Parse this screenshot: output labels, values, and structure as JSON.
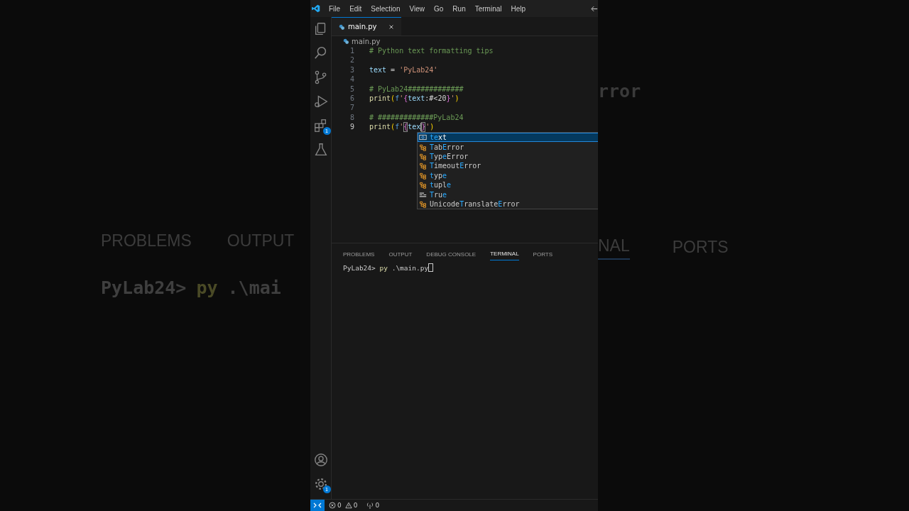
{
  "backdrop": {
    "left": [
      [
        {
          "kind": "tab",
          "text": "PROBLEMS"
        },
        {
          "kind": "tab",
          "text": "OUTPUT"
        }
      ],
      [
        {
          "kind": "prompt",
          "text": "PyLab24>"
        },
        {
          "kind": "command",
          "text": "py"
        },
        {
          "kind": "path",
          "text": ".\\mai"
        }
      ]
    ],
    "right": [
      [
        {
          "kind": "code",
          "text": "rror"
        }
      ],
      [
        {
          "kind": "active-tab",
          "text": "NAL"
        },
        {
          "kind": "tab",
          "text": "PORTS"
        }
      ]
    ]
  },
  "window": {
    "menu": [
      "File",
      "Edit",
      "Selection",
      "View",
      "Go",
      "Run",
      "Terminal",
      "Help"
    ]
  },
  "activity_bar": {
    "top": [
      {
        "kind": "files"
      },
      {
        "kind": "search"
      },
      {
        "kind": "branch"
      },
      {
        "kind": "run"
      },
      {
        "kind": "extensions",
        "badge": "1"
      },
      {
        "kind": "flask"
      }
    ],
    "bottom": [
      {
        "kind": "account"
      },
      {
        "kind": "gear",
        "badge": "1"
      }
    ]
  },
  "tabs": [
    {
      "label": "main.py",
      "selected": true
    }
  ],
  "breadcrumb": {
    "file": "main.py"
  },
  "editor": {
    "lines": [
      {
        "number": "1",
        "current": false,
        "tokens": [
          {
            "kind": "comment",
            "text": "# Python text formatting tips"
          }
        ]
      },
      {
        "number": "2",
        "current": false
      },
      {
        "number": "3",
        "current": false,
        "tokens": [
          {
            "kind": "variable",
            "text": "text"
          },
          {
            "kind": "operator",
            "text": " = "
          },
          {
            "kind": "string",
            "text": "'PyLab24'"
          }
        ]
      },
      {
        "number": "4",
        "current": false
      },
      {
        "number": "5",
        "current": false,
        "tokens": [
          {
            "kind": "comment",
            "text": "# PyLab24#############"
          }
        ]
      },
      {
        "number": "6",
        "current": false,
        "tokens": [
          {
            "kind": "function",
            "text": "print"
          },
          {
            "kind": "paren",
            "text": "("
          },
          {
            "kind": "keyword",
            "text": "f"
          },
          {
            "kind": "string",
            "text": "'"
          },
          {
            "kind": "brace",
            "text": "{"
          },
          {
            "kind": "variable",
            "text": "text"
          },
          {
            "kind": "operator",
            "text": ":#<20"
          },
          {
            "kind": "brace",
            "text": "}"
          },
          {
            "kind": "string",
            "text": "'"
          },
          {
            "kind": "paren",
            "text": ")"
          }
        ]
      },
      {
        "number": "7",
        "current": false
      },
      {
        "number": "8",
        "current": false,
        "tokens": [
          {
            "kind": "comment",
            "text": "# #############PyLab24"
          }
        ]
      },
      {
        "number": "9",
        "current": true,
        "tokens": [
          {
            "kind": "function",
            "text": "print"
          },
          {
            "kind": "paren",
            "text": "("
          },
          {
            "kind": "keyword",
            "text": "f"
          },
          {
            "kind": "string",
            "text": "'"
          },
          {
            "kind": "brace",
            "text": "{",
            "matched": true
          },
          {
            "kind": "variable",
            "text": "tex",
            "caret": true
          },
          {
            "kind": "brace",
            "text": "}",
            "matched": true
          },
          {
            "kind": "string",
            "text": "'"
          },
          {
            "kind": "paren",
            "text": ")"
          }
        ]
      }
    ],
    "suggestions": [
      {
        "kind": "variable",
        "selected": true,
        "label": [
          {
            "text": "te",
            "match": true
          },
          {
            "text": "xt",
            "match": false
          }
        ]
      },
      {
        "kind": "class",
        "selected": false,
        "label": [
          {
            "text": "T",
            "match": true
          },
          {
            "text": "ab",
            "match": false
          },
          {
            "text": "E",
            "match": true
          },
          {
            "text": "rror",
            "match": false
          }
        ]
      },
      {
        "kind": "class",
        "selected": false,
        "label": [
          {
            "text": "T",
            "match": true
          },
          {
            "text": "yp",
            "match": false
          },
          {
            "text": "e",
            "match": true
          },
          {
            "text": "Error",
            "match": false
          }
        ]
      },
      {
        "kind": "class",
        "selected": false,
        "label": [
          {
            "text": "T",
            "match": true
          },
          {
            "text": "imeout",
            "match": false
          },
          {
            "text": "E",
            "match": true
          },
          {
            "text": "rror",
            "match": false
          }
        ]
      },
      {
        "kind": "class",
        "selected": false,
        "label": [
          {
            "text": "t",
            "match": true
          },
          {
            "text": "yp",
            "match": false
          },
          {
            "text": "e",
            "match": true
          }
        ]
      },
      {
        "kind": "class",
        "selected": false,
        "label": [
          {
            "text": "t",
            "match": true
          },
          {
            "text": "upl",
            "match": false
          },
          {
            "text": "e",
            "match": true
          }
        ]
      },
      {
        "kind": "keyword",
        "selected": false,
        "label": [
          {
            "text": "T",
            "match": true
          },
          {
            "text": "ru",
            "match": false
          },
          {
            "text": "e",
            "match": true
          }
        ]
      },
      {
        "kind": "class",
        "selected": false,
        "label": [
          {
            "text": "Unicode",
            "match": false
          },
          {
            "text": "T",
            "match": true
          },
          {
            "text": "ranslate",
            "match": false
          },
          {
            "text": "E",
            "match": true
          },
          {
            "text": "rror",
            "match": false
          }
        ]
      }
    ]
  },
  "panel": {
    "tabs": [
      {
        "label": "PROBLEMS",
        "selected": false
      },
      {
        "label": "OUTPUT",
        "selected": false
      },
      {
        "label": "DEBUG CONSOLE",
        "selected": false
      },
      {
        "label": "TERMINAL",
        "selected": true
      },
      {
        "label": "PORTS",
        "selected": false
      }
    ],
    "terminal": {
      "prompt": "PyLab24>",
      "command": "py",
      "argument": ".\\main.py",
      "cursor": true
    }
  },
  "status_bar": {
    "errors": "0",
    "warnings": "0",
    "ports": "0"
  }
}
